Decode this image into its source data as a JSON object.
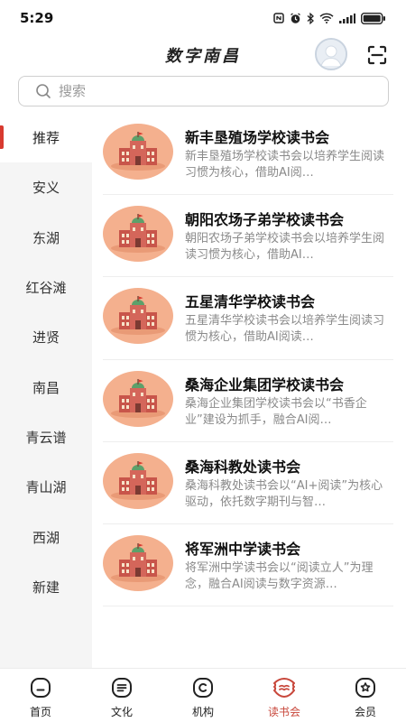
{
  "status": {
    "time": "5:29"
  },
  "header": {
    "title": "数字南昌"
  },
  "search": {
    "placeholder": "搜索"
  },
  "sidebar": {
    "items": [
      {
        "label": "推荐",
        "active": true
      },
      {
        "label": "安义"
      },
      {
        "label": "东湖"
      },
      {
        "label": "红谷滩"
      },
      {
        "label": "进贤"
      },
      {
        "label": "南昌"
      },
      {
        "label": "青云谱"
      },
      {
        "label": "青山湖"
      },
      {
        "label": "西湖"
      },
      {
        "label": "新建"
      }
    ]
  },
  "clubs": [
    {
      "title": "新丰垦殖场学校读书会",
      "desc": "新丰垦殖场学校读书会以培养学生阅读习惯为核心，借助AI阅…"
    },
    {
      "title": "朝阳农场子弟学校读书会",
      "desc": "朝阳农场子弟学校读书会以培养学生阅读习惯为核心，借助AI…"
    },
    {
      "title": "五星清华学校读书会",
      "desc": "五星清华学校读书会以培养学生阅读习惯为核心，借助AI阅读…"
    },
    {
      "title": "桑海企业集团学校读书会",
      "desc": "桑海企业集团学校读书会以“书香企业”建设为抓手，融合AI阅…"
    },
    {
      "title": "桑海科教处读书会",
      "desc": "桑海科教处读书会以“AI+阅读”为核心驱动，依托数字期刊与智…"
    },
    {
      "title": "将军洲中学读书会",
      "desc": "将军洲中学读书会以“阅读立人”为理念，融合AI阅读与数字资源…"
    }
  ],
  "tabs": [
    {
      "label": "首页",
      "icon": "home-icon"
    },
    {
      "label": "文化",
      "icon": "culture-icon"
    },
    {
      "label": "机构",
      "icon": "institution-icon"
    },
    {
      "label": "读书会",
      "icon": "reading-club-icon",
      "active": true
    },
    {
      "label": "会员",
      "icon": "member-icon"
    }
  ],
  "colors": {
    "accent": "#c8473b",
    "indicator": "#d83a2f",
    "thumb": "#f4b08e",
    "sidebar_bg": "#f5f5f5"
  }
}
